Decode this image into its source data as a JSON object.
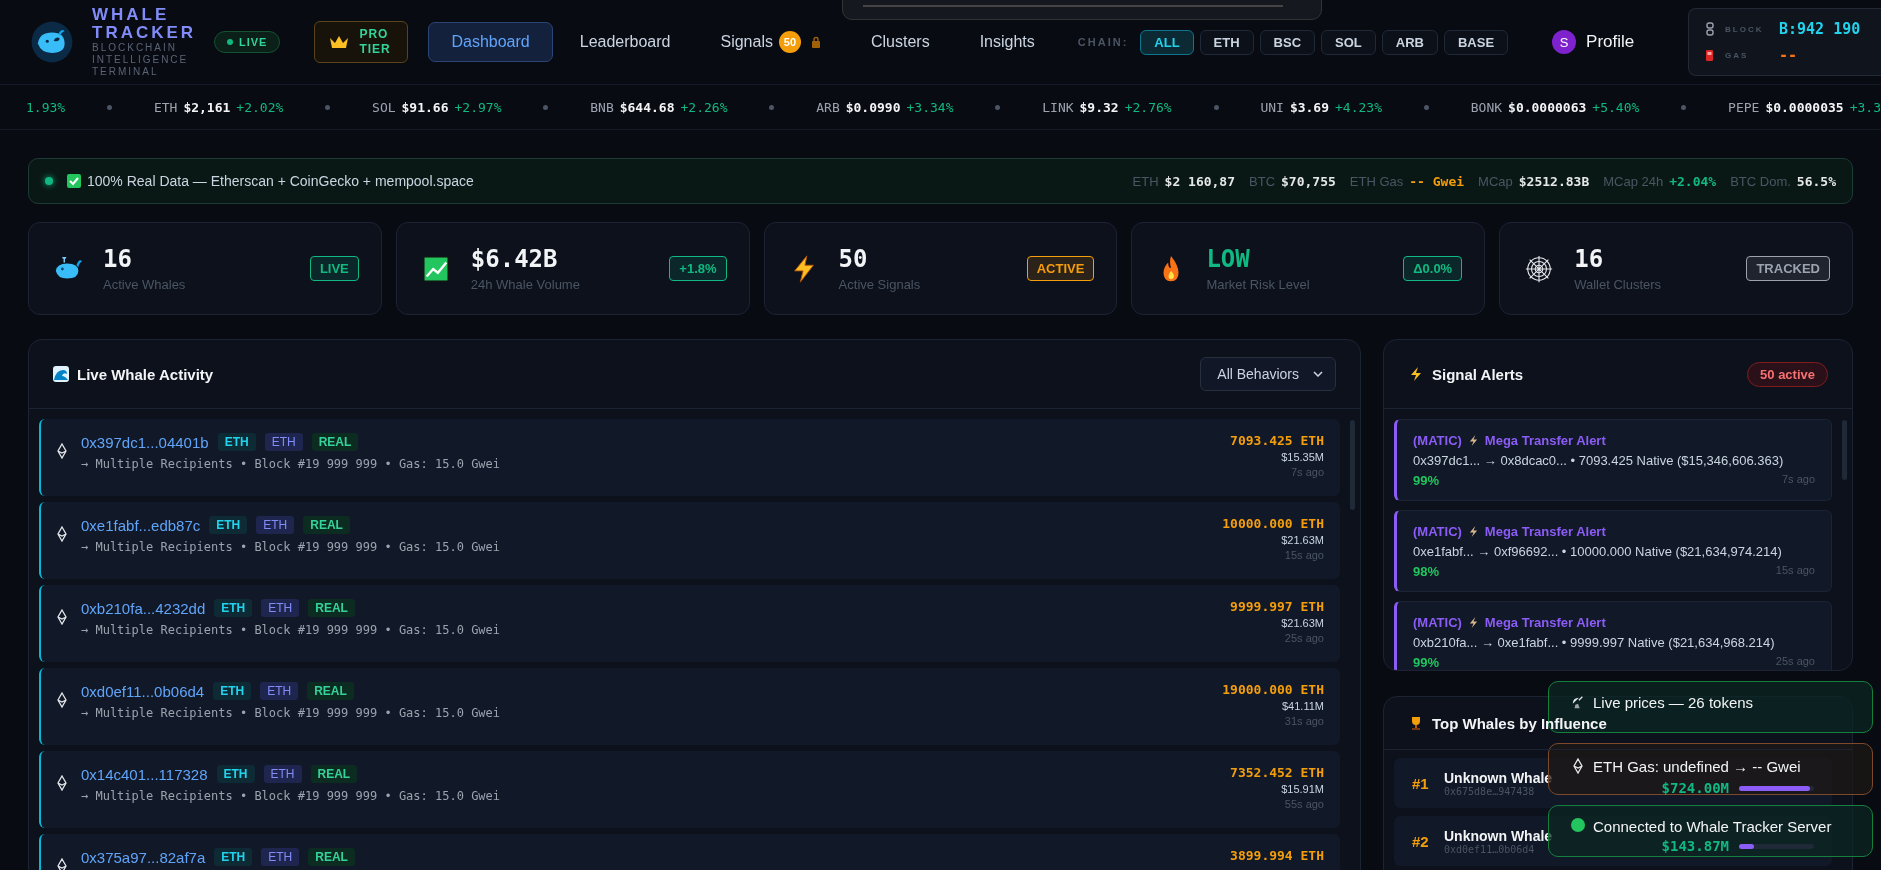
{
  "header": {
    "brand": "WHALE TRACKER",
    "tagline": "BLOCKCHAIN INTELLIGENCE TERMINAL",
    "live": "LIVE",
    "tier": "PRO TIER",
    "nav": [
      {
        "label": "Dashboard",
        "selected": true
      },
      {
        "label": "Leaderboard",
        "selected": false
      },
      {
        "label": "Signals",
        "selected": false,
        "badge": "50",
        "locked": true
      },
      {
        "label": "Clusters",
        "selected": false
      },
      {
        "label": "Insights",
        "selected": false
      }
    ],
    "chain_label": "CHAIN:",
    "chains": [
      {
        "label": "ALL",
        "selected": true
      },
      {
        "label": "ETH",
        "selected": false
      },
      {
        "label": "BSC",
        "selected": false
      },
      {
        "label": "SOL",
        "selected": false
      },
      {
        "label": "ARB",
        "selected": false
      },
      {
        "label": "BASE",
        "selected": false
      }
    ],
    "profile": {
      "initial": "S",
      "label": "Profile"
    },
    "block": {
      "block_label": "BLOCK",
      "block_value": "B:942 190",
      "gas_label": "GAS",
      "gas_value": "--"
    }
  },
  "ticker": [
    {
      "change": "1.93%"
    },
    {
      "symbol": "ETH",
      "price": "$2,161",
      "change": "+2.02%"
    },
    {
      "symbol": "SOL",
      "price": "$91.66",
      "change": "+2.97%"
    },
    {
      "symbol": "BNB",
      "price": "$644.68",
      "change": "+2.26%"
    },
    {
      "symbol": "ARB",
      "price": "$0.0990",
      "change": "+3.34%"
    },
    {
      "symbol": "LINK",
      "price": "$9.32",
      "change": "+2.76%"
    },
    {
      "symbol": "UNI",
      "price": "$3.69",
      "change": "+4.23%"
    },
    {
      "symbol": "BONK",
      "price": "$0.0000063",
      "change": "+5.40%"
    },
    {
      "symbol": "PEPE",
      "price": "$0.0000035",
      "change": "+3.3"
    }
  ],
  "banner": {
    "text": "100% Real Data — Etherscan + CoinGecko + mempool.space",
    "stats": [
      {
        "label": "ETH",
        "value": "$2 160,87",
        "kind": "plain"
      },
      {
        "label": "BTC",
        "value": "$70,755",
        "kind": "plain"
      },
      {
        "label": "ETH Gas",
        "value": "-- Gwei",
        "kind": "warn"
      },
      {
        "label": "MCap",
        "value": "$2512.83B",
        "kind": "plain"
      },
      {
        "label": "MCap 24h",
        "value": "+2.04%",
        "kind": "up"
      },
      {
        "label": "BTC Dom.",
        "value": "56.5%",
        "kind": "plain"
      }
    ]
  },
  "stats": [
    {
      "kind": "whale",
      "positive": false,
      "value": "16",
      "label": "Active Whales",
      "badge": "LIVE",
      "color": "#10b981"
    },
    {
      "kind": "chart",
      "positive": false,
      "value": "$6.42B",
      "label": "24h Whale Volume",
      "badge": "+1.8%",
      "color": "#10b981"
    },
    {
      "kind": "bolt",
      "positive": false,
      "value": "50",
      "label": "Active Signals",
      "badge": "ACTIVE",
      "color": "#f59e0b"
    },
    {
      "kind": "fire",
      "value": "LOW",
      "positive": true,
      "label": "Market Risk Level",
      "badge": "Δ0.0%",
      "color": "#10b981"
    },
    {
      "kind": "web",
      "positive": false,
      "value": "16",
      "label": "Wallet Clusters",
      "badge": "TRACKED",
      "color": "#9ca3af"
    }
  ],
  "activity": {
    "title": "Live Whale Activity",
    "filter": "All Behaviors",
    "rows": [
      {
        "address": "0x397dc1...04401b",
        "tags": [
          "ETH",
          "ETH",
          "REAL"
        ],
        "detail": "→ Multiple Recipients • Block #19 999 999 • Gas: 15.0 Gwei",
        "amount": "7093.425 ETH",
        "usd": "$15.35M",
        "time": "7s ago"
      },
      {
        "address": "0xe1fabf...edb87c",
        "tags": [
          "ETH",
          "ETH",
          "REAL"
        ],
        "detail": "→ Multiple Recipients • Block #19 999 999 • Gas: 15.0 Gwei",
        "amount": "10000.000 ETH",
        "usd": "$21.63M",
        "time": "15s ago"
      },
      {
        "address": "0xb210fa...4232dd",
        "tags": [
          "ETH",
          "ETH",
          "REAL"
        ],
        "detail": "→ Multiple Recipients • Block #19 999 999 • Gas: 15.0 Gwei",
        "amount": "9999.997 ETH",
        "usd": "$21.63M",
        "time": "25s ago"
      },
      {
        "address": "0xd0ef11...0b06d4",
        "tags": [
          "ETH",
          "ETH",
          "REAL"
        ],
        "detail": "→ Multiple Recipients • Block #19 999 999 • Gas: 15.0 Gwei",
        "amount": "19000.000 ETH",
        "usd": "$41.11M",
        "time": "31s ago"
      },
      {
        "address": "0x14c401...117328",
        "tags": [
          "ETH",
          "ETH",
          "REAL"
        ],
        "detail": "→ Multiple Recipients • Block #19 999 999 • Gas: 15.0 Gwei",
        "amount": "7352.452 ETH",
        "usd": "$15.91M",
        "time": "55s ago"
      },
      {
        "address": "0x375a97...82af7a",
        "tags": [
          "ETH",
          "ETH",
          "REAL"
        ],
        "amount": "3899.994 ETH"
      }
    ]
  },
  "signals": {
    "title": "Signal Alerts",
    "count": "50 active",
    "alerts": [
      {
        "chain": "(MATIC)",
        "title": "Mega Transfer Alert",
        "detail": "0x397dc1... → 0x8dcac0... • 7093.425 Native ($15,346,606.363)",
        "confidence": "99%",
        "time": "7s ago"
      },
      {
        "chain": "(MATIC)",
        "title": "Mega Transfer Alert",
        "detail": "0xe1fabf... → 0xf96692... • 10000.000 Native ($21,634,974.214)",
        "confidence": "98%",
        "time": "15s ago"
      },
      {
        "chain": "(MATIC)",
        "title": "Mega Transfer Alert",
        "detail": "0xb210fa... → 0xe1fabf... • 9999.997 Native ($21,634,968.214)",
        "confidence": "99%",
        "time": "25s ago"
      }
    ]
  },
  "top_whales": {
    "title": "Top Whales by Influence",
    "rows": [
      {
        "rank": "#1",
        "name": "Unknown Whale",
        "address": "0x675d8e…947438",
        "value": "$724.00M",
        "level": 0.95
      },
      {
        "rank": "#2",
        "name": "Unknown Whale",
        "address": "0xd0ef11…0b06d4",
        "value": "$143.87M",
        "level": 0.2
      }
    ]
  },
  "toasts": [
    {
      "kind": "info",
      "text": "Live prices — 26 tokens"
    },
    {
      "kind": "warning",
      "text": "ETH Gas: undefined → -- Gwei"
    },
    {
      "kind": "success",
      "text": "Connected to Whale Tracker Server"
    }
  ]
}
